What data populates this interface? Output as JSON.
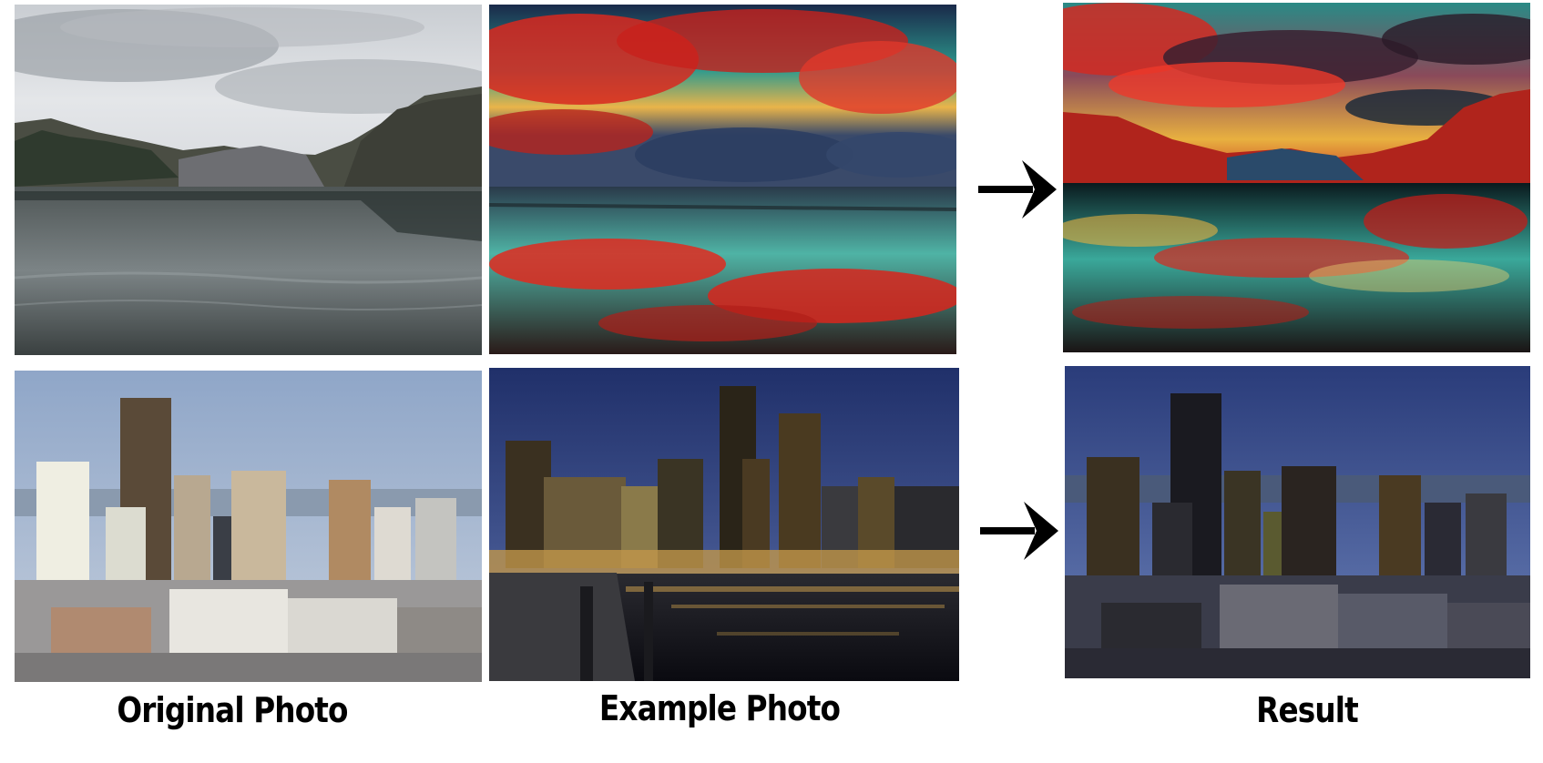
{
  "captions": {
    "original": "Original Photo",
    "example": "Example Photo",
    "result": "Result"
  },
  "colors": {
    "background": "#ffffff",
    "caption_text": "#000000",
    "arrow": "#000000"
  },
  "icons": {
    "arrow": "arrow-right-icon"
  },
  "photos": [
    {
      "row": 1,
      "role": "original",
      "subject": "gray-lake-mountains"
    },
    {
      "row": 1,
      "role": "example",
      "subject": "red-sunset-reflection"
    },
    {
      "row": 1,
      "role": "result",
      "subject": "stylized-red-lake"
    },
    {
      "row": 2,
      "role": "original",
      "subject": "daytime-city-skyline"
    },
    {
      "row": 2,
      "role": "example",
      "subject": "night-harbor-skyline"
    },
    {
      "row": 2,
      "role": "result",
      "subject": "stylized-night-city"
    }
  ]
}
